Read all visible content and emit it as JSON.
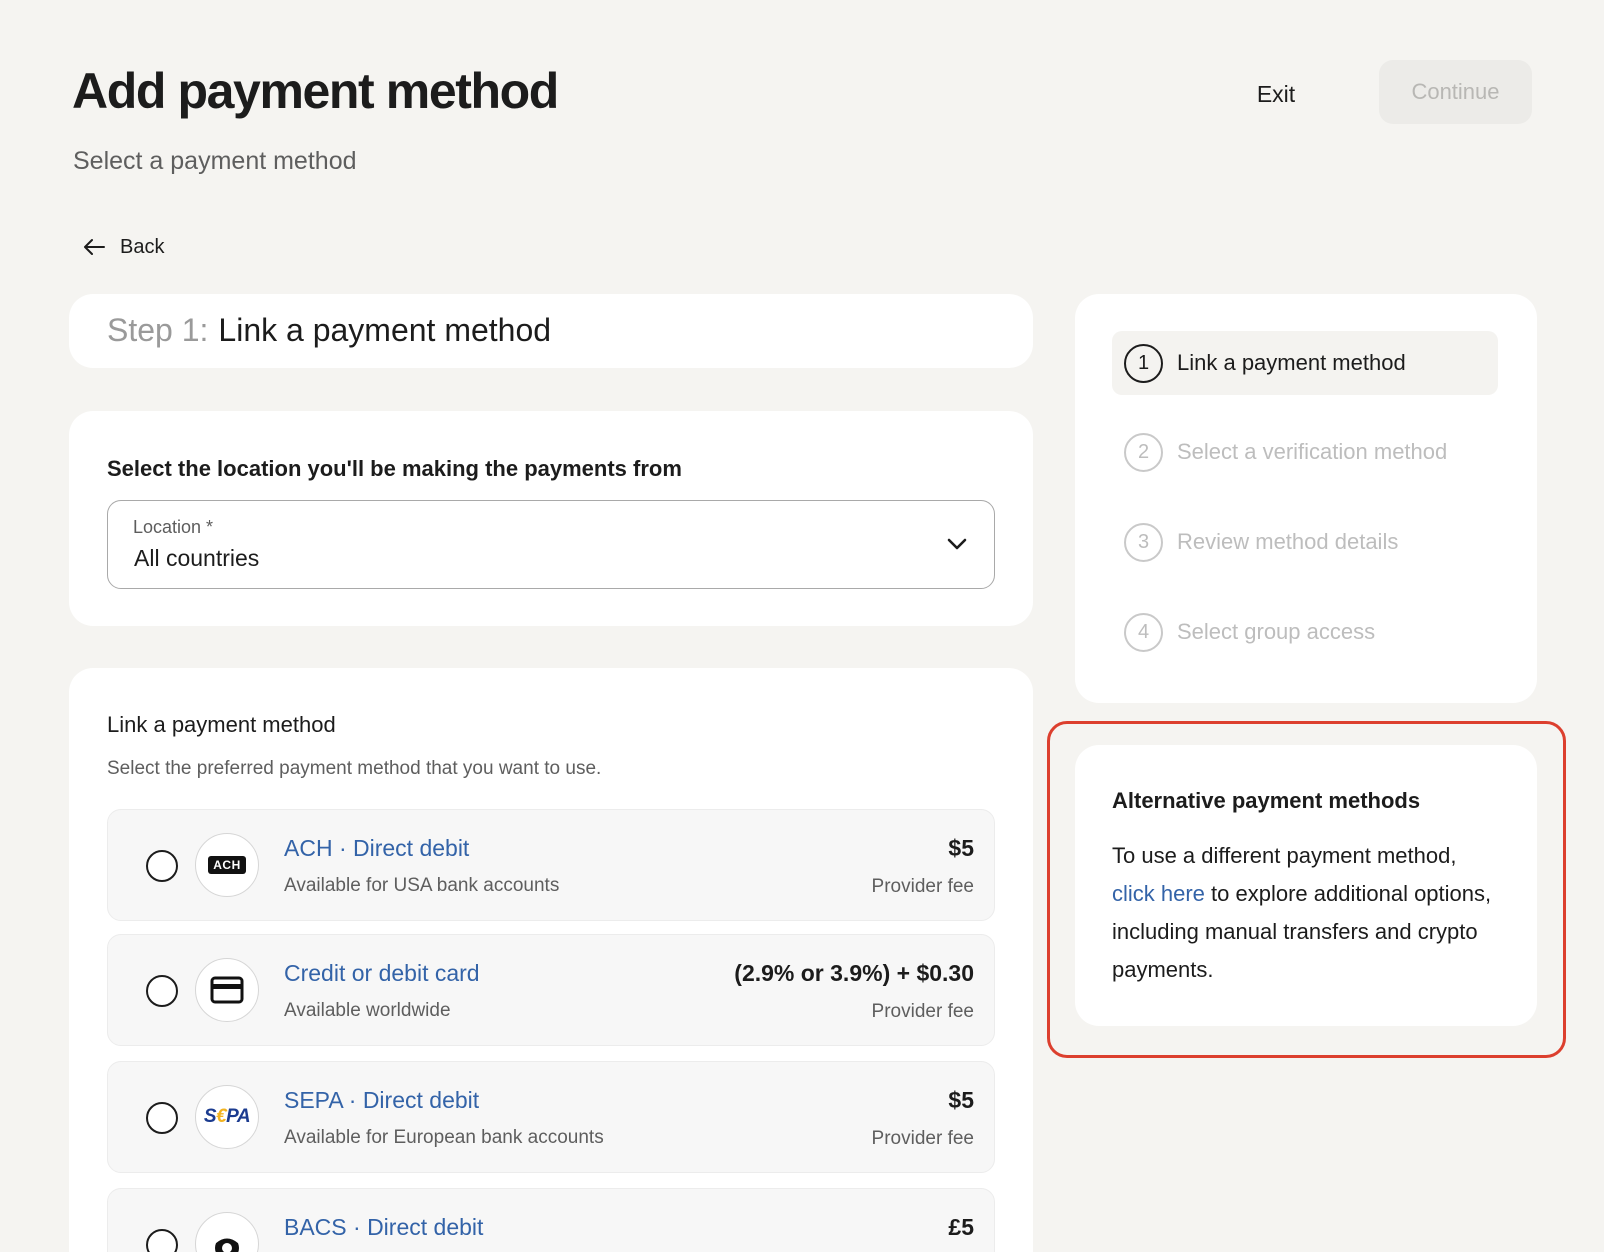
{
  "header": {
    "title": "Add payment method",
    "subtitle": "Select a payment method",
    "exit_label": "Exit",
    "continue_label": "Continue"
  },
  "back": {
    "label": "Back",
    "icon": "arrow-left-icon"
  },
  "step": {
    "prefix": "Step 1:",
    "name": "Link a payment method"
  },
  "location": {
    "heading": "Select the location you'll be making the payments from",
    "field_label": "Location *",
    "selected": "All countries",
    "icon": "chevron-down-icon"
  },
  "methods": {
    "heading": "Link a payment method",
    "subtitle": "Select the preferred payment method that you want to use.",
    "items": [
      {
        "name": "ACH · Direct debit",
        "description": "Available for USA bank accounts",
        "price": "$5",
        "fee_label": "Provider fee",
        "logo": "ACH",
        "icon": "ach-logo-icon"
      },
      {
        "name": "Credit or debit card",
        "description": "Available worldwide",
        "price": "(2.9% or 3.9%) + $0.30",
        "fee_label": "Provider fee",
        "icon": "credit-card-icon"
      },
      {
        "name": "SEPA · Direct debit",
        "description": "Available for European bank accounts",
        "price": "$5",
        "fee_label": "Provider fee",
        "logo_parts": [
          "S",
          "€",
          "PA"
        ],
        "icon": "sepa-logo-icon"
      },
      {
        "name": "BACS · Direct debit",
        "description": "",
        "price": "£5",
        "fee_label": "",
        "icon": "bacs-logo-icon"
      }
    ]
  },
  "stepper": {
    "items": [
      {
        "number": "1",
        "label": "Link a payment method",
        "active": true
      },
      {
        "number": "2",
        "label": "Select a verification method",
        "active": false
      },
      {
        "number": "3",
        "label": "Review method details",
        "active": false
      },
      {
        "number": "4",
        "label": "Select group access",
        "active": false
      }
    ]
  },
  "alternative": {
    "heading": "Alternative payment methods",
    "text_before": "To use a different payment method,",
    "link_text": "click here",
    "text_after": "to explore additional options, including manual transfers and crypto payments."
  },
  "colors": {
    "background": "#f5f4f1",
    "link": "#3363a8",
    "highlight": "#dc3f2e",
    "disabled_button": "#ecebe8"
  }
}
